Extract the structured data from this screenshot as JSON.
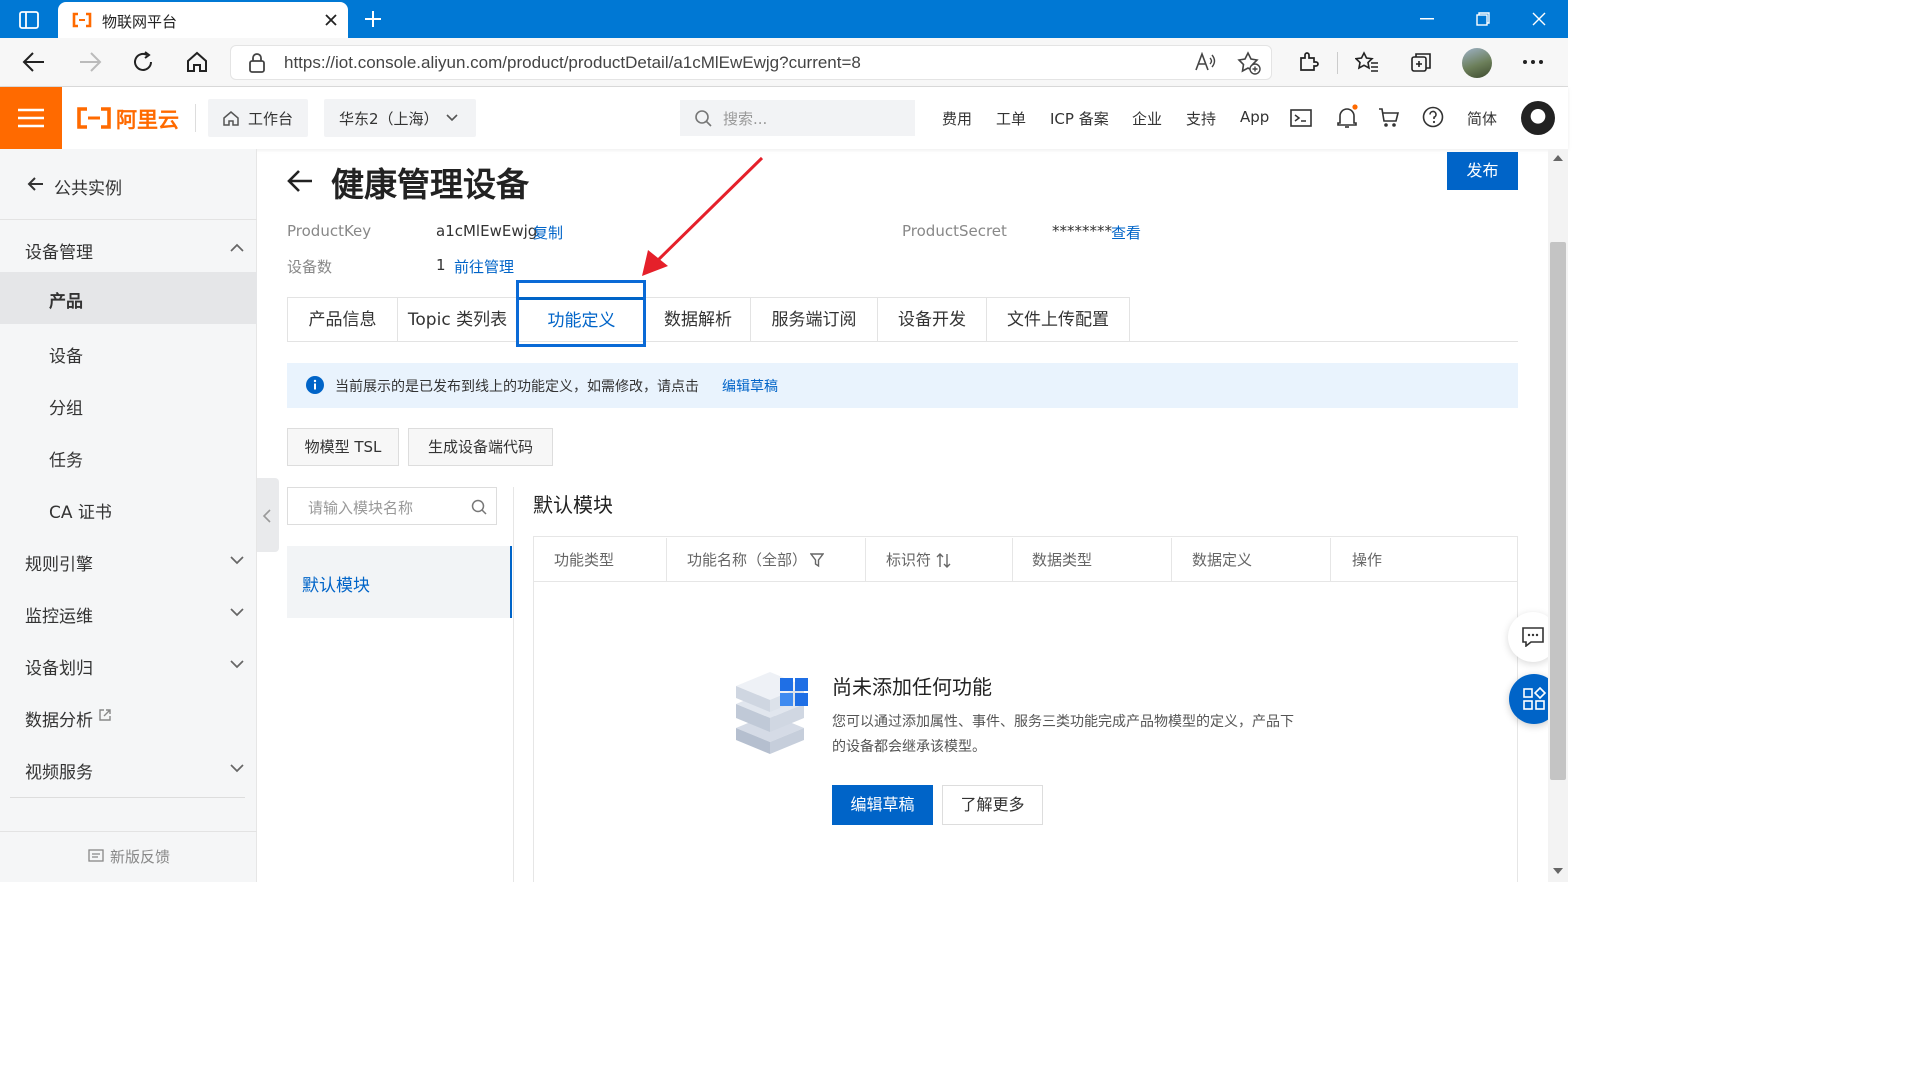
{
  "browser": {
    "tab_title": "物联网平台",
    "url": "https://iot.console.aliyun.com/product/productDetail/a1cMlEwEwjg?current=8"
  },
  "header": {
    "logo_text": "阿里云",
    "workbench": "工作台",
    "region": "华东2（上海）",
    "search_placeholder": "搜索...",
    "nav": [
      "费用",
      "工单",
      "ICP 备案",
      "企业",
      "支持",
      "App"
    ],
    "lang": "简体"
  },
  "sidebar": {
    "back_label": "公共实例",
    "groups": [
      {
        "label": "设备管理",
        "expanded": true
      },
      {
        "label": "规则引擎"
      },
      {
        "label": "监控运维"
      },
      {
        "label": "设备划归"
      },
      {
        "label": "数据分析"
      },
      {
        "label": "视频服务"
      }
    ],
    "sub_items": [
      "产品",
      "设备",
      "分组",
      "任务",
      "CA 证书"
    ],
    "active_sub": "产品",
    "feedback": "新版反馈"
  },
  "page": {
    "title": "健康管理设备",
    "publish": "发布",
    "product_key_label": "ProductKey",
    "product_key": "a1cMlEwEwjg",
    "copy": "复制",
    "product_secret_label": "ProductSecret",
    "product_secret": "********",
    "view": "查看",
    "device_count_label": "设备数",
    "device_count": "1",
    "goto_manage": "前往管理"
  },
  "tabs": [
    "产品信息",
    "Topic 类列表",
    "功能定义",
    "数据解析",
    "服务端订阅",
    "设备开发",
    "文件上传配置"
  ],
  "active_tab": "功能定义",
  "notice": {
    "text": "当前展示的是已发布到线上的功能定义，如需修改，请点击",
    "link": "编辑草稿"
  },
  "actions": {
    "tsl": "物模型 TSL",
    "gen_code": "生成设备端代码"
  },
  "module": {
    "search_placeholder": "请输入模块名称",
    "list": [
      "默认模块"
    ],
    "heading": "默认模块"
  },
  "table": {
    "columns": [
      "功能类型",
      "功能名称（全部）",
      "标识符",
      "数据类型",
      "数据定义",
      "操作"
    ]
  },
  "empty": {
    "title": "尚未添加任何功能",
    "desc1": "您可以通过添加属性、事件、服务三类功能完成产品物模型的定义，产品下",
    "desc2": "的设备都会继承该模型。",
    "edit_draft": "编辑草稿",
    "learn_more": "了解更多"
  },
  "colors": {
    "brand": "#ff6a00",
    "primary": "#0064c8",
    "annotation": "#e5202a",
    "browser_blue": "#0078d4"
  }
}
